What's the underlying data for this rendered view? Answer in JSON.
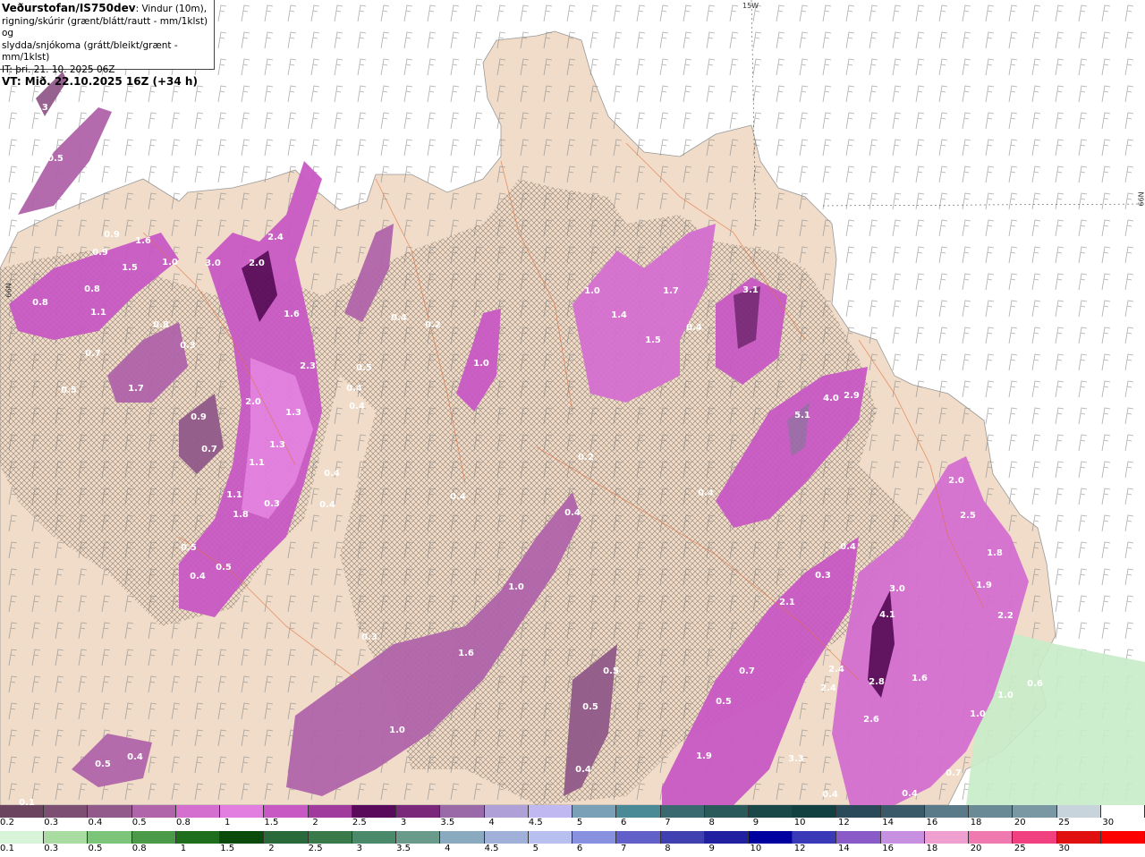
{
  "title": {
    "source": "Veðurstofan/IS750dev",
    "description_1": ": Vindur (10m),",
    "description_2": "rigning/skúrir (grænt/blátt/rautt - mm/1klst) og",
    "description_3": "slydda/snjókoma (grátt/bleikt/grænt - mm/1klst)",
    "issue_time": "IT: þri. 21. 10. 2025 06Z",
    "valid_time": "VT: Mið. 22.10.2025 16Z (+34 h)"
  },
  "graticule": {
    "lon_label": "15W",
    "lat_label_right": "66N",
    "lat_label_left": "66N"
  },
  "precip_labels": [
    "0.3",
    "0.5",
    "0.9",
    "1.6",
    "0.9",
    "1.5",
    "0.8",
    "1.1",
    "0.8",
    "0.7",
    "0.5",
    "0.8",
    "0.3",
    "1.7",
    "0.9",
    "0.7",
    "1.0",
    "3.0",
    "2.0",
    "2.4",
    "1.6",
    "2.3",
    "2.0",
    "1.3",
    "1.3",
    "1.1",
    "1.1",
    "1.8",
    "0.3",
    "0.5",
    "0.5",
    "0.4",
    "0.4",
    "0.4",
    "0.4",
    "0.4",
    "0.5",
    "0.4",
    "0.2",
    "1.0",
    "0.4",
    "0.2",
    "0.4",
    "1.0",
    "1.6",
    "1.0",
    "0.3",
    "1.4",
    "1.0",
    "1.7",
    "1.5",
    "0.4",
    "3.1",
    "4.0",
    "2.9",
    "5.1",
    "0.4",
    "0.4",
    "0.3",
    "2.1",
    "2.0",
    "2.5",
    "1.8",
    "1.9",
    "3.0",
    "4.1",
    "2.2",
    "2.4",
    "2.4",
    "2.8",
    "2.6",
    "1.6",
    "0.7",
    "0.5",
    "1.9",
    "3.3",
    "0.4",
    "0.5",
    "0.5",
    "0.4",
    "1.0",
    "1.0",
    "0.6",
    "0.7",
    "0.4",
    "0.5",
    "0.4",
    "0.1"
  ],
  "colorbar_top": {
    "labels": [
      "0.2",
      "0.3",
      "0.4",
      "0.5",
      "0.8",
      "1",
      "1.5",
      "2",
      "2.5",
      "3",
      "3.5",
      "4",
      "4.5",
      "5",
      "6",
      "7",
      "8",
      "9",
      "10",
      "12",
      "14",
      "16",
      "18",
      "20",
      "25",
      "30"
    ],
    "colors": [
      "#6b4560",
      "#7d4f72",
      "#925a8a",
      "#b064aa",
      "#d46fd0",
      "#e27ee0",
      "#c859c4",
      "#a03a9c",
      "#5a0a5a",
      "#7a287a",
      "#9a6aa8",
      "#b0a0d8",
      "#c0b8f0",
      "#7aa0b8",
      "#4a8a96",
      "#3a6a70",
      "#2a5a5a",
      "#1a4848",
      "#124040",
      "#2a4a5a",
      "#3a5a6a",
      "#5a7a8a",
      "#6a8a96",
      "#7a98a4",
      "#c8d4dc",
      "#ffffff"
    ]
  },
  "colorbar_bottom": {
    "labels": [
      "0.1",
      "0.3",
      "0.5",
      "0.8",
      "1",
      "1.5",
      "2",
      "2.5",
      "3",
      "3.5",
      "4",
      "4.5",
      "5",
      "6",
      "7",
      "8",
      "9",
      "10",
      "12",
      "14",
      "16",
      "18",
      "20",
      "25",
      "30"
    ],
    "colors": [
      "#d8f4d8",
      "#a8dca0",
      "#7cc47a",
      "#4a9a4a",
      "#1e6e1e",
      "#0a4a0a",
      "#2a6a3a",
      "#3a7a4a",
      "#4a8a6a",
      "#6a9a8a",
      "#8aaac0",
      "#a0b0d8",
      "#b8c0f0",
      "#8890e0",
      "#6060c8",
      "#4040b0",
      "#2020a0",
      "#0000a0",
      "#3a3ab8",
      "#8a5ac8",
      "#c890e0",
      "#f0a0d0",
      "#f07ab0",
      "#f04080",
      "#e01010",
      "#ff0000"
    ]
  },
  "colors": {
    "land": "#f0dcc8",
    "sea": "#ffffff",
    "border": "#e07040",
    "heavy": "#e27ee0",
    "medium": "#b064aa",
    "light": "#6b4560"
  }
}
